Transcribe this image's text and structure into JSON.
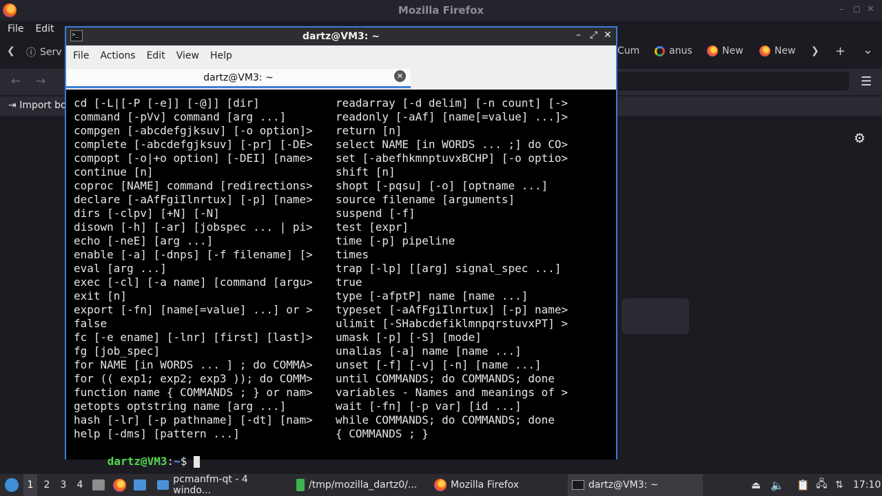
{
  "firefox": {
    "window_title": "Mozilla Firefox",
    "menu": [
      "File",
      "Edit"
    ],
    "tabs": [
      "Serv",
      "Cum",
      "anus",
      "New",
      "New"
    ],
    "bookmark_label": "Import bo",
    "nav_back": "←",
    "nav_forward": "→",
    "tab_scroll_left": "❮",
    "tab_scroll_right": "❯",
    "new_tab": "+",
    "tab_list": "⌄",
    "menu_icon": "☰",
    "settings_icon": "⚙",
    "win_min": "–",
    "win_max": "◻",
    "win_close": "✕"
  },
  "terminal": {
    "window_title": "dartz@VM3: ~",
    "menu": [
      "File",
      "Actions",
      "Edit",
      "View",
      "Help"
    ],
    "tab_label": "dartz@VM3: ~",
    "tab_close": "✕",
    "ctl_min": "–",
    "ctl_max": "⤢",
    "ctl_close": "✕",
    "icon_text": ">_",
    "lines_left": [
      "cd [-L|[-P [-e]] [-@]] [dir]",
      "command [-pVv] command [arg ...]",
      "compgen [-abcdefgjksuv] [-o option]>",
      "complete [-abcdefgjksuv] [-pr] [-DE>",
      "compopt [-o|+o option] [-DEI] [name>",
      "continue [n]",
      "coproc [NAME] command [redirections>",
      "declare [-aAfFgiIlnrtux] [-p] [name>",
      "dirs [-clpv] [+N] [-N]",
      "disown [-h] [-ar] [jobspec ... | pi>",
      "echo [-neE] [arg ...]",
      "enable [-a] [-dnps] [-f filename] [>",
      "eval [arg ...]",
      "exec [-cl] [-a name] [command [argu>",
      "exit [n]",
      "export [-fn] [name[=value] ...] or >",
      "false",
      "fc [-e ename] [-lnr] [first] [last]>",
      "fg [job_spec]",
      "for NAME [in WORDS ... ] ; do COMMA>",
      "for (( exp1; exp2; exp3 )); do COMM>",
      "function name { COMMANDS ; } or nam>",
      "getopts optstring name [arg ...]",
      "hash [-lr] [-p pathname] [-dt] [nam>",
      "help [-dms] [pattern ...]"
    ],
    "lines_right": [
      "readarray [-d delim] [-n count] [->",
      "readonly [-aAf] [name[=value] ...]>",
      "return [n]",
      "select NAME [in WORDS ... ;] do CO>",
      "set [-abefhkmnptuvxBCHP] [-o optio>",
      "shift [n]",
      "shopt [-pqsu] [-o] [optname ...]",
      "source filename [arguments]",
      "suspend [-f]",
      "test [expr]",
      "time [-p] pipeline",
      "times",
      "trap [-lp] [[arg] signal_spec ...]",
      "true",
      "type [-afptP] name [name ...]",
      "typeset [-aAfFgiIlnrtux] [-p] name>",
      "ulimit [-SHabcdefiklmnpqrstuvxPT] >",
      "umask [-p] [-S] [mode]",
      "unalias [-a] name [name ...]",
      "unset [-f] [-v] [-n] [name ...]",
      "until COMMANDS; do COMMANDS; done",
      "variables - Names and meanings of >",
      "wait [-fn] [-p var] [id ...]",
      "while COMMANDS; do COMMANDS; done",
      "{ COMMANDS ; }"
    ],
    "prompt_user": "dartz@VM3",
    "prompt_sep": ":",
    "prompt_path": "~",
    "prompt_symbol": "$ "
  },
  "taskbar": {
    "workspaces": [
      "1",
      "2",
      "3",
      "4"
    ],
    "tasks": [
      {
        "label": "pcmanfm-qt - 4 windo..."
      },
      {
        "label": "/tmp/mozilla_dartz0/..."
      },
      {
        "label": "Mozilla Firefox"
      },
      {
        "label": "dartz@VM3: ~"
      }
    ],
    "clock": "17:10"
  }
}
